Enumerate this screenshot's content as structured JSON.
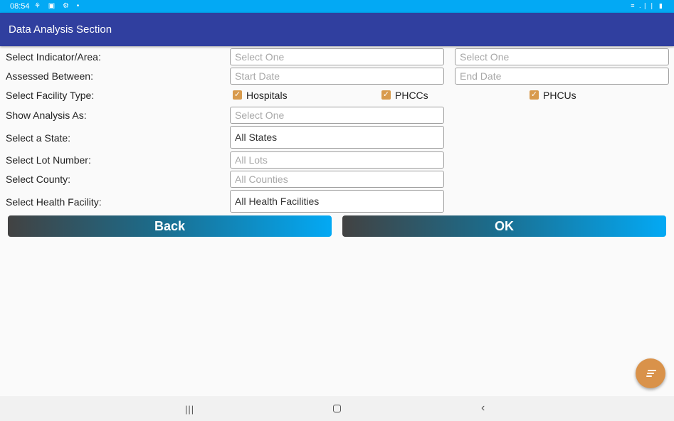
{
  "status_bar": {
    "time": "08:54",
    "left_icons": "⚘ ▣ ⚙ •",
    "right_icons": "≡ .❘❘ ▮"
  },
  "app_bar": {
    "title": "Data Analysis Section"
  },
  "form": {
    "indicator": {
      "label": "Select Indicator/Area:",
      "placeholder1": "Select One",
      "placeholder2": "Select One"
    },
    "assessed": {
      "label": "Assessed Between:",
      "start_placeholder": "Start Date",
      "end_placeholder": "End Date"
    },
    "facility_type": {
      "label": "Select Facility Type:",
      "options": [
        {
          "label": "Hospitals",
          "checked": true
        },
        {
          "label": "PHCCs",
          "checked": true
        },
        {
          "label": "PHCUs",
          "checked": true
        }
      ]
    },
    "show_as": {
      "label": "Show Analysis As:",
      "placeholder": "Select One"
    },
    "state": {
      "label": "Select a State:",
      "value": "All States"
    },
    "lot": {
      "label": "Select Lot Number:",
      "placeholder": "All Lots"
    },
    "county": {
      "label": "Select County:",
      "placeholder": "All Counties"
    },
    "health_facility": {
      "label": "Select Health Facility:",
      "value": "All Health Facilities"
    }
  },
  "buttons": {
    "back": "Back",
    "ok": "OK"
  },
  "fab": {
    "icon": "notes-icon",
    "color": "#d9924a"
  },
  "colors": {
    "status_bar": "#03a9f4",
    "app_bar": "#303f9f",
    "checkbox": "#d89a4c"
  },
  "nav_bar": {
    "recent": "|||",
    "back": "‹"
  }
}
